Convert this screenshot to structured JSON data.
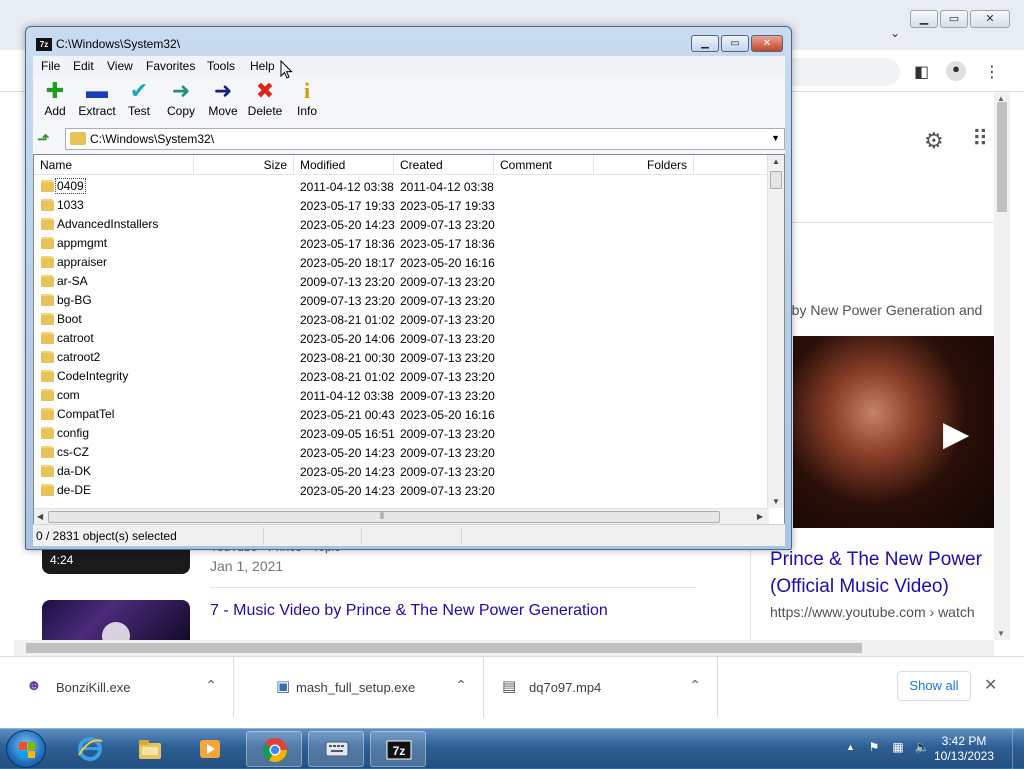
{
  "sevenzip": {
    "title": "C:\\Windows\\System32\\",
    "menu": [
      "File",
      "Edit",
      "View",
      "Favorites",
      "Tools",
      "Help"
    ],
    "toolbar": [
      {
        "label": "Add",
        "icon": "plus-icon",
        "glyph": "✚",
        "color": "#1e9e1e"
      },
      {
        "label": "Extract",
        "icon": "minus-icon",
        "glyph": "▬",
        "color": "#1c3fb7"
      },
      {
        "label": "Test",
        "icon": "check-icon",
        "glyph": "✔",
        "color": "#1fa8b8"
      },
      {
        "label": "Copy",
        "icon": "copy-arrow-icon",
        "glyph": "➜",
        "color": "#1f8f7a"
      },
      {
        "label": "Move",
        "icon": "move-arrow-icon",
        "glyph": "➜",
        "color": "#14207a"
      },
      {
        "label": "Delete",
        "icon": "delete-x-icon",
        "glyph": "✖",
        "color": "#d8281e"
      },
      {
        "label": "Info",
        "icon": "info-icon",
        "glyph": "i",
        "color": "#c7a300"
      }
    ],
    "address": "C:\\Windows\\System32\\",
    "columns": [
      "Name",
      "Size",
      "Modified",
      "Created",
      "Comment",
      "Folders"
    ],
    "rows": [
      {
        "name": "0409",
        "modified": "2011-04-12 03:38",
        "created": "2011-04-12 03:38"
      },
      {
        "name": "1033",
        "modified": "2023-05-17 19:33",
        "created": "2023-05-17 19:33"
      },
      {
        "name": "AdvancedInstallers",
        "modified": "2023-05-20 14:23",
        "created": "2009-07-13 23:20"
      },
      {
        "name": "appmgmt",
        "modified": "2023-05-17 18:36",
        "created": "2023-05-17 18:36"
      },
      {
        "name": "appraiser",
        "modified": "2023-05-20 18:17",
        "created": "2023-05-20 16:16"
      },
      {
        "name": "ar-SA",
        "modified": "2009-07-13 23:20",
        "created": "2009-07-13 23:20"
      },
      {
        "name": "bg-BG",
        "modified": "2009-07-13 23:20",
        "created": "2009-07-13 23:20"
      },
      {
        "name": "Boot",
        "modified": "2023-08-21 01:02",
        "created": "2009-07-13 23:20"
      },
      {
        "name": "catroot",
        "modified": "2023-05-20 14:06",
        "created": "2009-07-13 23:20"
      },
      {
        "name": "catroot2",
        "modified": "2023-08-21 00:30",
        "created": "2009-07-13 23:20"
      },
      {
        "name": "CodeIntegrity",
        "modified": "2023-08-21 01:02",
        "created": "2009-07-13 23:20"
      },
      {
        "name": "com",
        "modified": "2011-04-12 03:38",
        "created": "2009-07-13 23:20"
      },
      {
        "name": "CompatTel",
        "modified": "2023-05-21 00:43",
        "created": "2023-05-20 16:16"
      },
      {
        "name": "config",
        "modified": "2023-09-05 16:51",
        "created": "2009-07-13 23:20"
      },
      {
        "name": "cs-CZ",
        "modified": "2023-05-20 14:23",
        "created": "2009-07-13 23:20"
      },
      {
        "name": "da-DK",
        "modified": "2023-05-20 14:23",
        "created": "2009-07-13 23:20"
      },
      {
        "name": "de-DE",
        "modified": "2023-05-20 14:23",
        "created": "2009-07-13 23:20"
      }
    ],
    "status": "0 / 2831 object(s) selected"
  },
  "browser": {
    "knowledge_snippet": "g by New Power Generation and",
    "knowledge_title_1": "Prince & The New Power",
    "knowledge_title_2": "(Official Music Video)",
    "knowledge_url": "https://www.youtube.com › watch",
    "result1_duration": "4:24",
    "result1_source": "YouTube · Prince · Topic",
    "result1_date": "Jan 1, 2021",
    "result2_title": "7 - Music Video by Prince & The New Power Generation"
  },
  "downloads": {
    "items": [
      {
        "name": "BonziKill.exe",
        "icon": "bonzi-app-icon"
      },
      {
        "name": "mash_full_setup.exe",
        "icon": "installer-icon"
      },
      {
        "name": "dq7o97.mp4",
        "icon": "video-file-icon"
      }
    ],
    "show_all": "Show all"
  },
  "taskbar": {
    "time": "3:42 PM",
    "date": "10/13/2023"
  },
  "colors": {
    "link": "#1a0dab",
    "accent_blue": "#1a73e8",
    "taskbar": "#2e5f94"
  }
}
